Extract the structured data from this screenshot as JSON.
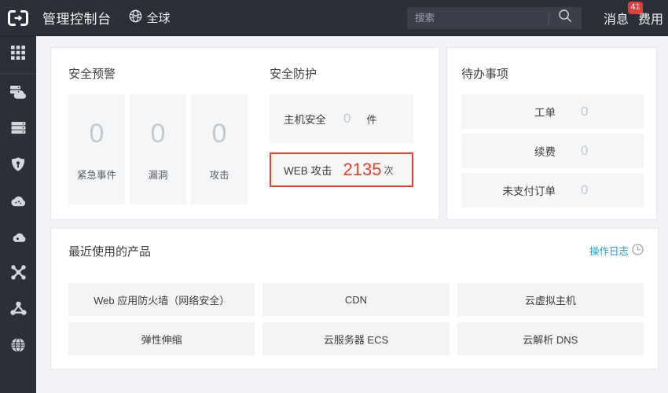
{
  "header": {
    "logo_icon": "link-bracket-logo",
    "console_title": "管理控制台",
    "region_icon": "globe-icon",
    "region_label": "全球",
    "search": {
      "placeholder": "搜索",
      "value": "",
      "icon": "search-icon"
    },
    "nav": [
      {
        "label": "消息",
        "badge": "41"
      },
      {
        "label": "费用",
        "badge": ""
      }
    ]
  },
  "sidebar": {
    "items": [
      {
        "name": "apps",
        "icon": "grid-apps-icon"
      },
      {
        "name": "elastic-compute",
        "icon": "server-cloud-icon"
      },
      {
        "name": "database",
        "icon": "database-icon"
      },
      {
        "name": "security",
        "icon": "shield-icon"
      },
      {
        "name": "cloud",
        "icon": "cloud-icon"
      },
      {
        "name": "storage",
        "icon": "cloud-disk-icon"
      },
      {
        "name": "network",
        "icon": "network-cross-icon"
      },
      {
        "name": "nodes",
        "icon": "share-nodes-icon"
      },
      {
        "name": "domain",
        "icon": "globe-grid-icon"
      }
    ]
  },
  "security_alert": {
    "title": "安全预警",
    "tiles": [
      {
        "value": "0",
        "label": "紧急事件"
      },
      {
        "value": "0",
        "label": "漏洞"
      },
      {
        "value": "0",
        "label": "攻击"
      }
    ]
  },
  "security_protection": {
    "title": "安全防护",
    "rows": [
      {
        "label": "主机安全",
        "value": "0",
        "unit": "件",
        "highlight": false
      },
      {
        "label": "WEB 攻击",
        "value": "2135",
        "unit": "次",
        "highlight": true
      }
    ]
  },
  "todo": {
    "title": "待办事项",
    "rows": [
      {
        "label": "工单",
        "value": "0"
      },
      {
        "label": "续费",
        "value": "0"
      },
      {
        "label": "未支付订单",
        "value": "0"
      }
    ]
  },
  "products": {
    "title": "最近使用的产品",
    "oplog_label": "操作日志",
    "oplog_icon": "clock-icon",
    "items": [
      "Web 应用防火墙（网络安全）",
      "CDN",
      "云虚拟主机",
      "弹性伸缩",
      "云服务器 ECS",
      "云解析 DNS"
    ]
  },
  "colors": {
    "topbar_bg": "#2b2f38",
    "page_bg": "#f0f2f5",
    "card_bg": "#ffffff",
    "tile_bg": "#f5f6f7",
    "accent_red": "#e8402a",
    "badge_red": "#e63c3c",
    "link_blue": "#1a9dd9",
    "muted_number": "#c4c8cd"
  }
}
